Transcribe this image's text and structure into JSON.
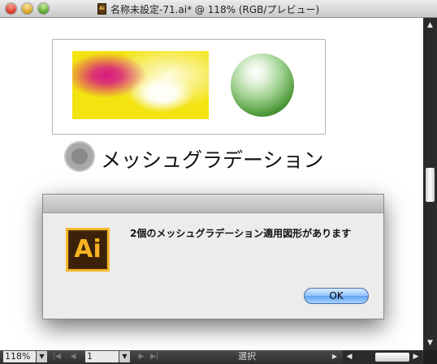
{
  "window": {
    "title": "名称未設定-71.ai* @ 118% (RGB/プレビュー)",
    "doc_icon_text": "Ai"
  },
  "canvas": {
    "heading": "メッシュグラデーション"
  },
  "dialog": {
    "message": "2個のメッシュグラデーション適用図形があります",
    "logo_text": "Ai",
    "ok_label": "OK"
  },
  "statusbar": {
    "zoom": "118%",
    "page": "1",
    "mode": "選択"
  },
  "icons": {
    "scroll_up": "▲",
    "scroll_down": "▼",
    "scroll_left": "◀",
    "scroll_right": "▶",
    "dropdown": "▼",
    "first": "|◀",
    "prev": "◀",
    "next": "▶",
    "last": "▶|",
    "play": "▶"
  },
  "colors": {
    "mesh_yellow": "#f3e310",
    "mesh_magenta": "#d81a82",
    "sphere_green": "#4f9a3b",
    "ok_button_blue": "#5fa2f2",
    "logo_orange": "#f6b92d"
  }
}
